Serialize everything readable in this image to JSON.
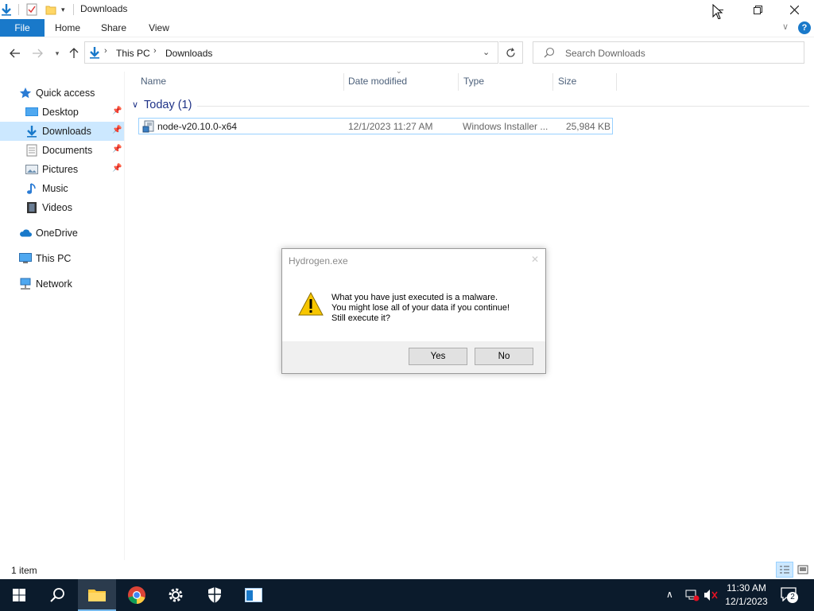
{
  "window": {
    "title": "Downloads"
  },
  "ribbon": {
    "tabs": [
      "File",
      "Home",
      "Share",
      "View"
    ]
  },
  "address": {
    "segments": [
      "This PC",
      "Downloads"
    ]
  },
  "search": {
    "placeholder": "Search Downloads"
  },
  "sidebar": {
    "items": [
      {
        "label": "Quick access",
        "icon": "star-icon"
      },
      {
        "label": "Desktop",
        "icon": "desktop-icon",
        "pinned": true
      },
      {
        "label": "Downloads",
        "icon": "download-icon",
        "pinned": true,
        "selected": true
      },
      {
        "label": "Documents",
        "icon": "documents-icon",
        "pinned": true
      },
      {
        "label": "Pictures",
        "icon": "pictures-icon",
        "pinned": true
      },
      {
        "label": "Music",
        "icon": "music-icon"
      },
      {
        "label": "Videos",
        "icon": "videos-icon"
      },
      {
        "label": "OneDrive",
        "icon": "cloud-icon"
      },
      {
        "label": "This PC",
        "icon": "computer-icon"
      },
      {
        "label": "Network",
        "icon": "network-icon"
      }
    ]
  },
  "columns": [
    "Name",
    "Date modified",
    "Type",
    "Size"
  ],
  "group": {
    "label": "Today (1)"
  },
  "files": [
    {
      "name": "node-v20.10.0-x64",
      "date": "12/1/2023 11:27 AM",
      "type": "Windows Installer ...",
      "size": "25,984 KB"
    }
  ],
  "status": {
    "item_count": "1 item"
  },
  "dialog": {
    "title": "Hydrogen.exe",
    "message_lines": [
      "What you have just executed is a malware.",
      "You might lose all of your data if you continue!",
      "Still execute it?"
    ],
    "yes_label": "Yes",
    "no_label": "No"
  },
  "taskbar": {
    "time": "11:30 AM",
    "date": "12/1/2023",
    "notification_count": "2"
  },
  "colors": {
    "accent": "#1979ca",
    "selection": "#cce8ff",
    "taskbar": "#0b1b2c",
    "group_header": "#1e3287"
  }
}
